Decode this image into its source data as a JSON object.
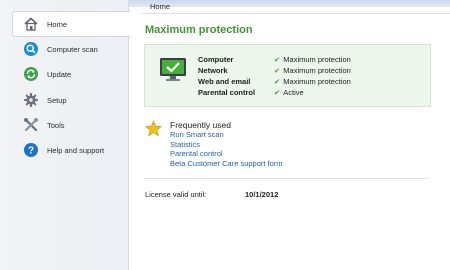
{
  "sidebar": {
    "items": [
      {
        "label": "Home",
        "icon": "home-icon",
        "active": true
      },
      {
        "label": "Computer scan",
        "icon": "magnifier-icon",
        "active": false
      },
      {
        "label": "Update",
        "icon": "refresh-icon",
        "active": false
      },
      {
        "label": "Setup",
        "icon": "gear-icon",
        "active": false
      },
      {
        "label": "Tools",
        "icon": "tools-icon",
        "active": false
      },
      {
        "label": "Help and support",
        "icon": "help-icon",
        "active": false
      }
    ]
  },
  "breadcrumb": "Home",
  "page_title": "Maximum protection",
  "status": {
    "rows": [
      {
        "key": "Computer",
        "value": "Maximum protection"
      },
      {
        "key": "Network",
        "value": "Maximum protection"
      },
      {
        "key": "Web and email",
        "value": "Maximum protection"
      },
      {
        "key": "Parental control",
        "value": "Active"
      }
    ]
  },
  "frequently_used": {
    "title": "Frequently used",
    "links": [
      "Run Smart scan",
      "Statistics",
      "Parental control",
      "Beta Customer Care support form"
    ]
  },
  "license": {
    "label": "License valid until:",
    "value": "10/1/2012"
  },
  "colors": {
    "accent_green": "#3c9a2f",
    "link_blue": "#1f5fb5",
    "panel_bg": "#edf6ec"
  }
}
